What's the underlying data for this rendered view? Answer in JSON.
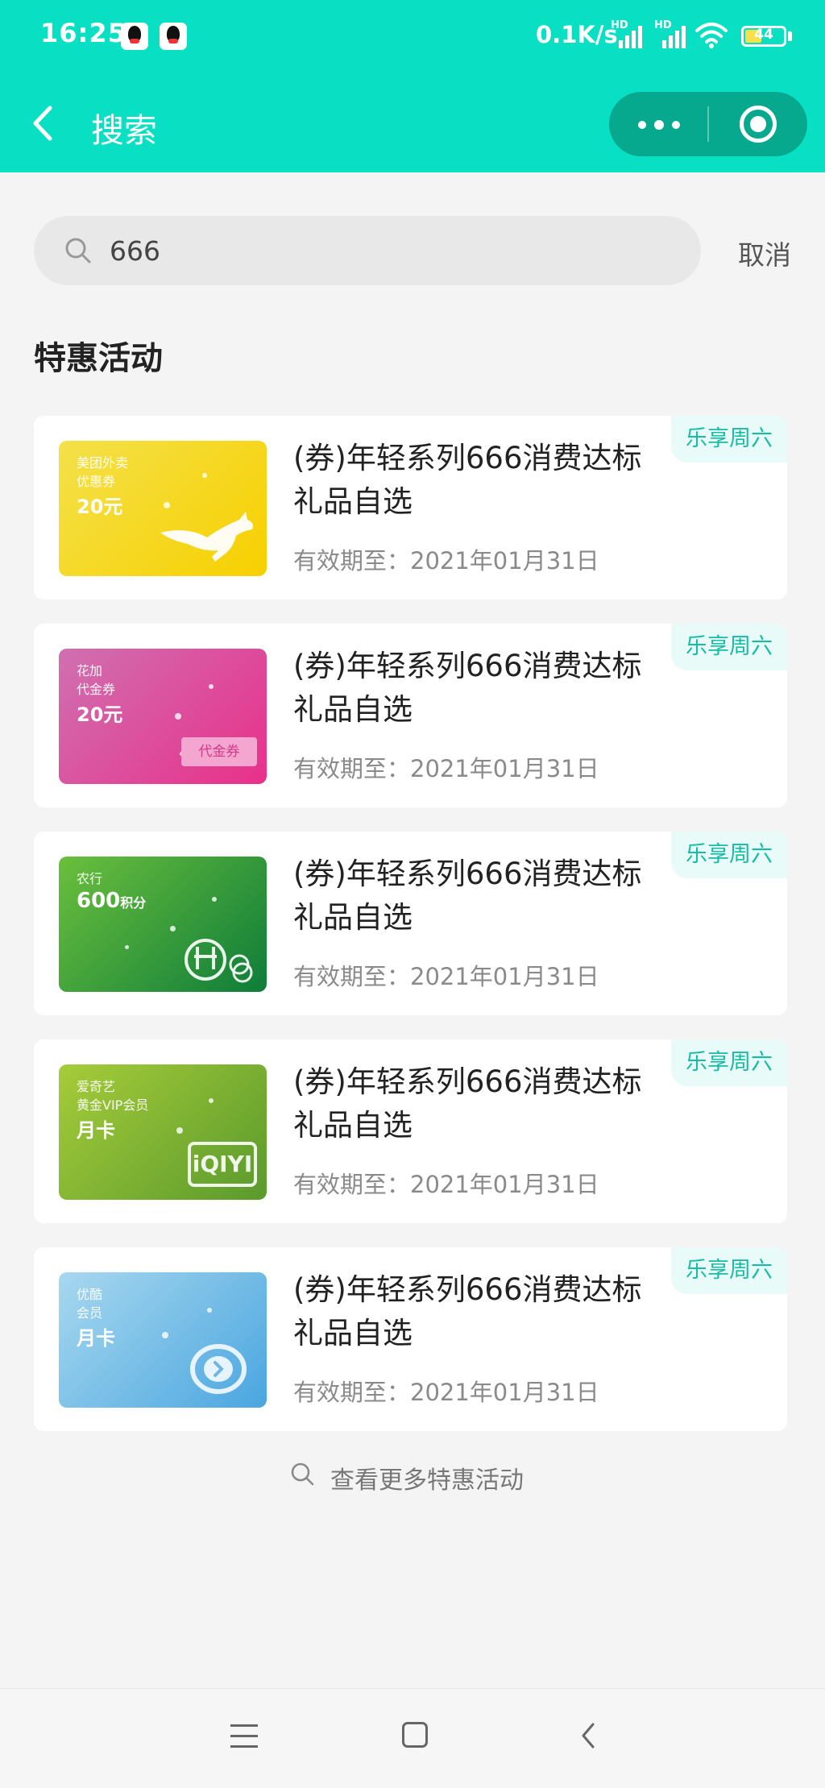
{
  "status_bar": {
    "time": "16:25",
    "network_speed": "0.1K/s",
    "signal_label": "HD",
    "battery_level": "44",
    "icons": [
      "qq-icon",
      "qq-icon",
      "signal-icon",
      "signal-icon",
      "wifi-icon",
      "battery-icon"
    ]
  },
  "nav": {
    "title": "搜索",
    "back_icon": "chevron-left-icon",
    "more_icon": "more-dots-icon",
    "close_icon": "target-icon",
    "color": "#08dfc3"
  },
  "search": {
    "value": "666",
    "placeholder": "",
    "cancel_label": "取消"
  },
  "section_title": "特惠活动",
  "cards": [
    {
      "tag": "乐享周六",
      "title": "(券)年轻系列666消费达标礼品自选",
      "expire": "有效期至：2021年01月31日",
      "coupon": {
        "line1": "美团外卖",
        "line2": "优惠券",
        "amount": "20元",
        "gradient": [
          "#f4e14a",
          "#f7d000"
        ],
        "icon": "kangaroo-icon"
      }
    },
    {
      "tag": "乐享周六",
      "title": "(券)年轻系列666消费达标礼品自选",
      "expire": "有效期至：2021年01月31日",
      "coupon": {
        "line1": "花加",
        "line2": "代金券",
        "amount": "20元",
        "stamp": "代金券",
        "gradient": [
          "#d070b0",
          "#e8308a"
        ],
        "icon": "ticket-icon"
      }
    },
    {
      "tag": "乐享周六",
      "title": "(券)年轻系列666消费达标礼品自选",
      "expire": "有效期至：2021年01月31日",
      "coupon": {
        "line1": "农行",
        "line2": "",
        "amount": "600",
        "amount_unit": "积分",
        "gradient": [
          "#6bbf3c",
          "#0e7d3a"
        ],
        "icon": "abc-bank-icon"
      }
    },
    {
      "tag": "乐享周六",
      "title": "(券)年轻系列666消费达标礼品自选",
      "expire": "有效期至：2021年01月31日",
      "coupon": {
        "line1": "爱奇艺",
        "line2": "黄金VIP会员",
        "amount": "月卡",
        "logo": "iQIYI",
        "gradient": [
          "#a6cc3a",
          "#5a9a2c"
        ],
        "icon": "iqiyi-icon"
      }
    },
    {
      "tag": "乐享周六",
      "title": "(券)年轻系列666消费达标礼品自选",
      "expire": "有效期至：2021年01月31日",
      "coupon": {
        "line1": "优酷",
        "line2": "会员",
        "amount": "月卡",
        "gradient": [
          "#a8d8ef",
          "#4aa6e0"
        ],
        "icon": "youku-icon"
      }
    }
  ],
  "more_link": "查看更多特惠活动",
  "system_nav": {
    "icons": [
      "menu-icon",
      "home-icon",
      "back-icon"
    ]
  }
}
